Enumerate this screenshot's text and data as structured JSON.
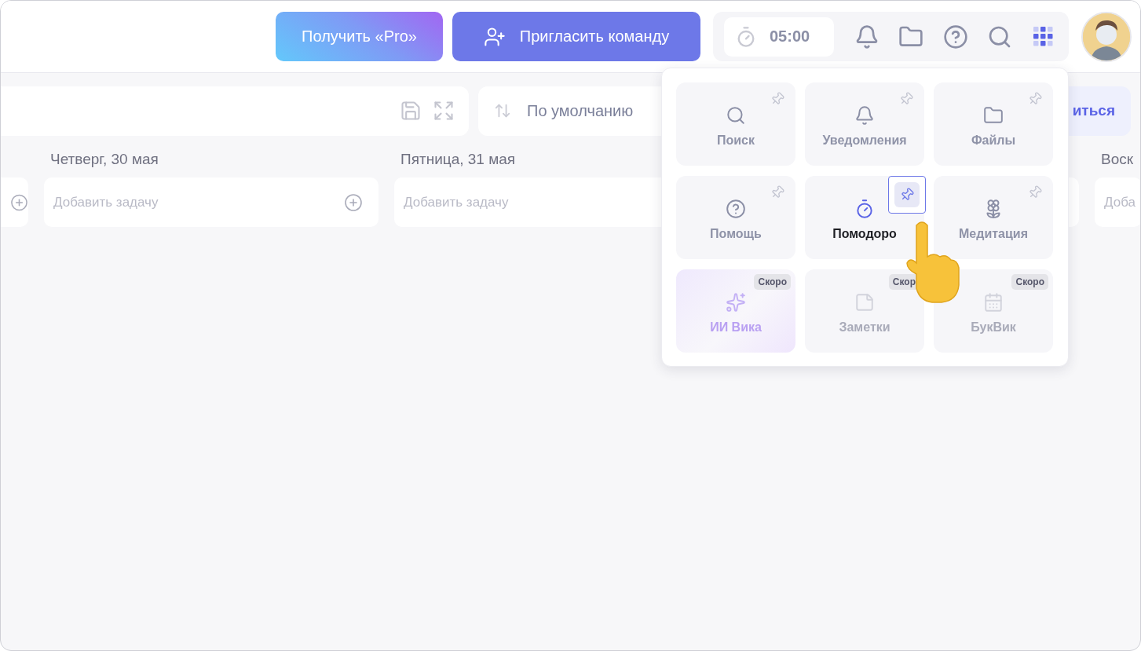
{
  "header": {
    "pro_button": "Получить «Pro»",
    "invite_button": "Пригласить команду",
    "timer": "05:00",
    "tools": [
      {
        "selected": false
      },
      {
        "selected": false
      },
      {
        "selected": false
      },
      {
        "selected": false
      },
      {
        "selected": true
      }
    ]
  },
  "toolbar": {
    "sort": "По умолчанию",
    "share_button": "иться"
  },
  "days": [
    {
      "kind": "partial"
    },
    {
      "kind": "day",
      "title": "Четверг, 30 мая",
      "placeholder": "Добавить задачу"
    },
    {
      "kind": "day",
      "title": "Пятница, 31 мая",
      "placeholder": "Добавить задачу"
    },
    {
      "kind": "partial"
    },
    {
      "kind": "day",
      "title": "Воск",
      "placeholder": "Доба"
    }
  ],
  "menu": {
    "tiles": [
      {
        "label": "Поиск",
        "kind": "tool",
        "hovered": false
      },
      {
        "label": "Уведомления",
        "kind": "tool",
        "hovered": false
      },
      {
        "label": "Файлы",
        "kind": "tool",
        "hovered": false
      },
      {
        "label": "Помощь",
        "kind": "tool",
        "hovered": false
      },
      {
        "label": "Помодоро",
        "kind": "tool",
        "hovered": true
      },
      {
        "label": "Медитация",
        "kind": "tool",
        "hovered": false
      },
      {
        "label": "ИИ Вика",
        "kind": "ai",
        "badge": "Скоро"
      },
      {
        "label": "Заметки",
        "kind": "soon",
        "badge": "Скор"
      },
      {
        "label": "БукВик",
        "kind": "soon",
        "badge": "Скоро"
      }
    ]
  }
}
